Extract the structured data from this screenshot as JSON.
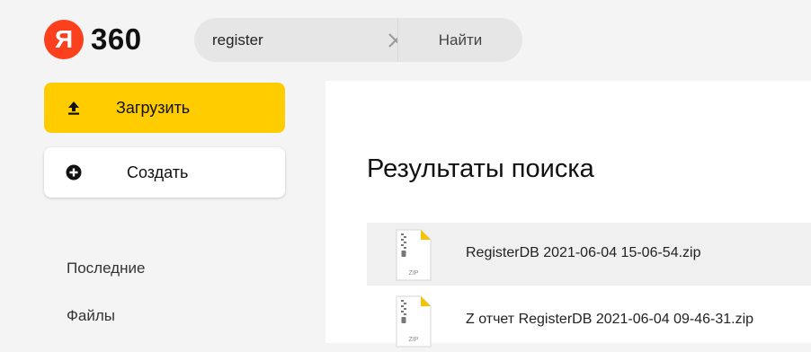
{
  "header": {
    "logo_letter": "Я",
    "logo_text": "360",
    "search_value": "register",
    "search_button": "Найти"
  },
  "sidebar": {
    "upload_label": "Загрузить",
    "create_label": "Создать",
    "nav": [
      "Последние",
      "Файлы"
    ]
  },
  "main": {
    "title": "Результаты поиска",
    "results": [
      {
        "name": "RegisterDB 2021-06-04 15-06-54.zip",
        "type_label": "ZIP",
        "selected": true
      },
      {
        "name": "Z отчет RegisterDB 2021-06-04 09-46-31.zip",
        "type_label": "ZIP",
        "selected": false
      }
    ]
  },
  "colors": {
    "brand_red": "#fc3f1d",
    "accent_yellow": "#ffcc00"
  }
}
